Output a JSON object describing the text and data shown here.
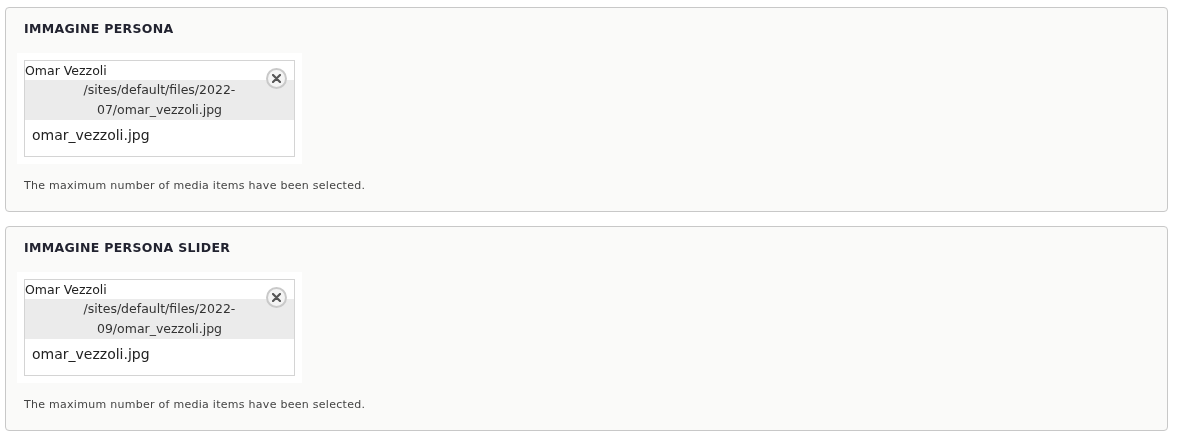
{
  "sections": [
    {
      "title": "IMMAGINE PERSONA",
      "media": {
        "name": "Omar Vezzoli",
        "path": "/sites/default/files/2022-07/omar_vezzoli.jpg",
        "filename": "omar_vezzoli.jpg"
      },
      "note": "The maximum number of media items have been selected."
    },
    {
      "title": "IMMAGINE PERSONA SLIDER",
      "media": {
        "name": "Omar Vezzoli",
        "path": "/sites/default/files/2022-09/omar_vezzoli.jpg",
        "filename": "omar_vezzoli.jpg"
      },
      "note": "The maximum number of media items have been selected."
    }
  ]
}
